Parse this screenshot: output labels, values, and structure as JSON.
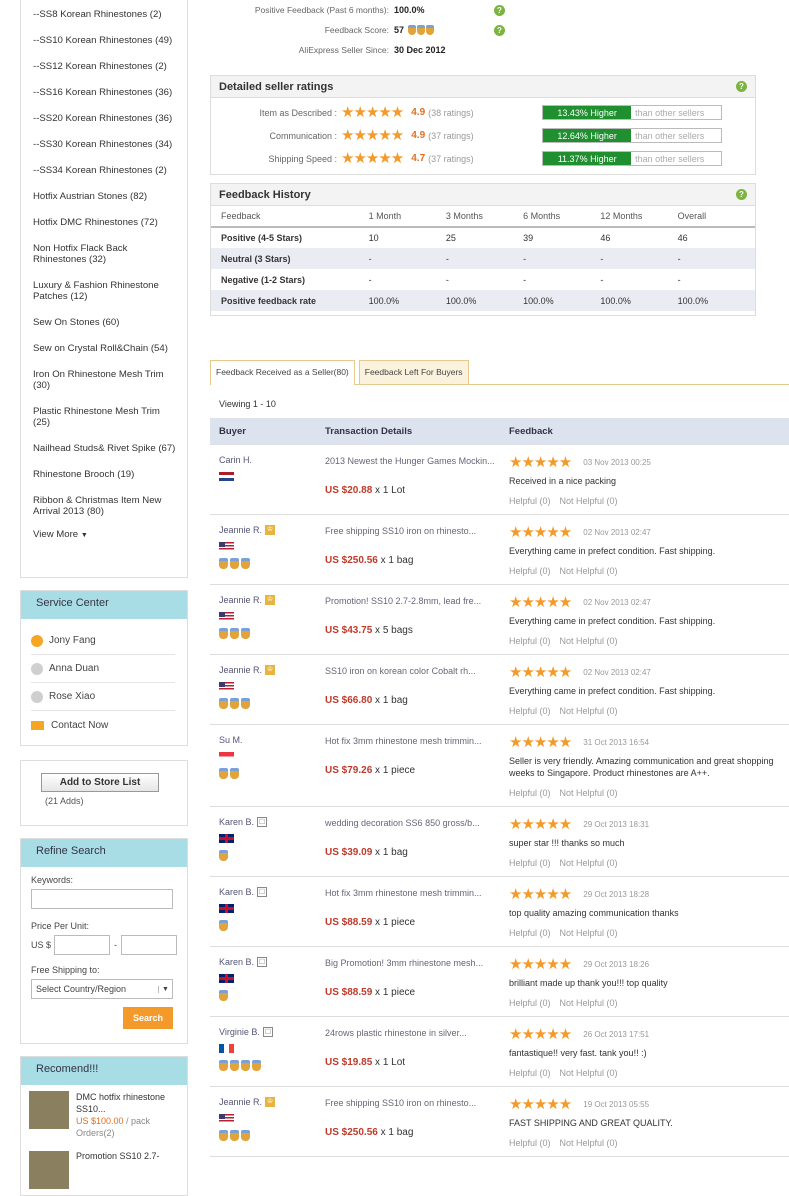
{
  "categories": [
    "--SS8 Korean Rhinestones (2)",
    "--SS10 Korean Rhinestones (49)",
    "--SS12 Korean Rhinestones (2)",
    "--SS16 Korean Rhinestones (36)",
    "--SS20 Korean Rhinestones (36)",
    "--SS30 Korean Rhinestones (34)",
    "--SS34 Korean Rhinestones (2)",
    "Hotfix Austrian Stones (82)",
    "Hotfix DMC Rhinestones (72)",
    "Non Hotfix Flack Back Rhinestones (32)",
    "Luxury & Fashion Rhinestone Patches (12)",
    "Sew On Stones (60)",
    "Sew on Crystal Roll&Chain (54)",
    "Iron On Rhinestone Mesh Trim (30)",
    "Plastic Rhinestone Mesh Trim (25)",
    "Nailhead Studs& Rivet Spike (67)",
    "Rhinestone Brooch (19)",
    "Ribbon & Christmas Item New Arrival 2013 (80)"
  ],
  "view_more": "View More",
  "service": {
    "title": "Service Center",
    "reps": [
      {
        "name": "Jony Fang",
        "color": "#f5a623"
      },
      {
        "name": "Anna Duan",
        "color": "#cfcfcf"
      },
      {
        "name": "Rose Xiao",
        "color": "#cfcfcf"
      }
    ],
    "contact": "Contact Now"
  },
  "store": {
    "button": "Add to Store List",
    "adds": "(21 Adds)"
  },
  "refine": {
    "title": "Refine Search",
    "keywords": "Keywords:",
    "price_label": "Price Per Unit:",
    "currency": "US $",
    "dash": "-",
    "ship_label": "Free Shipping to:",
    "country": "Select Country/Region",
    "search": "Search"
  },
  "recommend": {
    "title": "Recomend!!!",
    "items": [
      {
        "name": "DMC hotfix rhinestone SS10...",
        "price": "US $100.00",
        "unit": " / pack",
        "orders": "Orders(2)"
      },
      {
        "name": "Promotion SS10 2.7-"
      }
    ]
  },
  "seller": {
    "pos_label": "Positive Feedback (Past 6 months):",
    "pos_value": "100.0%",
    "score_label": "Feedback Score:",
    "score_value": "57",
    "since_label": "AliExpress Seller Since:",
    "since_value": "30 Dec 2012"
  },
  "ratings": {
    "title": "Detailed seller ratings",
    "rows": [
      {
        "label": "Item as Described :",
        "score": "4.9",
        "count": "(38 ratings)",
        "pct": "13.43% Higher",
        "than": "than other sellers"
      },
      {
        "label": "Communication :",
        "score": "4.9",
        "count": "(37 ratings)",
        "pct": "12.64% Higher",
        "than": "than other sellers"
      },
      {
        "label": "Shipping Speed :",
        "score": "4.7",
        "count": "(37 ratings)",
        "pct": "11.37% Higher",
        "than": "than other sellers"
      }
    ]
  },
  "history": {
    "title": "Feedback History",
    "headers": [
      "Feedback",
      "1 Month",
      "3 Months",
      "6 Months",
      "12 Months",
      "Overall"
    ],
    "rows": [
      [
        "Positive (4-5 Stars)",
        "10",
        "25",
        "39",
        "46",
        "46"
      ],
      [
        "Neutral (3 Stars)",
        "-",
        "-",
        "-",
        "-",
        "-"
      ],
      [
        "Negative (1-2 Stars)",
        "-",
        "-",
        "-",
        "-",
        "-"
      ],
      [
        "Positive feedback rate",
        "100.0%",
        "100.0%",
        "100.0%",
        "100.0%",
        "100.0%"
      ]
    ]
  },
  "tabs": [
    "Feedback Received as a Seller(80)",
    "Feedback Left For Buyers"
  ],
  "viewing": "Viewing 1 - 10",
  "fb_headers": [
    "Buyer",
    "Transaction Details",
    "Feedback"
  ],
  "helpful": "Helpful (0)",
  "not_helpful": "Not Helpful (0)",
  "feedback": [
    {
      "buyer": "Carin H.",
      "badge": "",
      "flag": "nl",
      "medals": 0,
      "desc": "2013 Newest the Hunger Games Mockin...",
      "price": "US $20.88",
      "qty": " x 1 Lot",
      "date": "03 Nov 2013 00:25",
      "text": "Received in a nice packing"
    },
    {
      "buyer": "Jeannie R.",
      "badge": "o",
      "flag": "us",
      "medals": 3,
      "desc": "Free shipping SS10 iron on rhinesto...",
      "price": "US $250.56",
      "qty": " x 1 bag",
      "date": "02 Nov 2013 02:47",
      "text": "Everything came in prefect condition. Fast shipping."
    },
    {
      "buyer": "Jeannie R.",
      "badge": "o",
      "flag": "us",
      "medals": 3,
      "desc": "Promotion! SS10 2.7-2.8mm, lead fre...",
      "price": "US $43.75",
      "qty": " x 5 bags",
      "date": "02 Nov 2013 02:47",
      "text": "Everything came in prefect condition. Fast shipping."
    },
    {
      "buyer": "Jeannie R.",
      "badge": "o",
      "flag": "us",
      "medals": 3,
      "desc": "SS10 iron on korean color Cobalt rh...",
      "price": "US $66.80",
      "qty": " x 1 bag",
      "date": "02 Nov 2013 02:47",
      "text": "Everything came in prefect condition. Fast shipping."
    },
    {
      "buyer": "Su M.",
      "badge": "",
      "flag": "sg",
      "medals": 2,
      "desc": "Hot fix 3mm rhinestone mesh trimmin...",
      "price": "US $79.26",
      "qty": " x 1 piece",
      "date": "31 Oct 2013 16:54",
      "text": "Seller is very friendly. Amazing communication and great shopping weeks to Singapore. Product rhinestones are A++."
    },
    {
      "buyer": "Karen B.",
      "badge": "g",
      "flag": "uk",
      "medals": 1,
      "desc": "wedding decoration SS6 850 gross/b...",
      "price": "US $39.09",
      "qty": " x 1 bag",
      "date": "29 Oct 2013 18:31",
      "text": "super star !!! thanks so much"
    },
    {
      "buyer": "Karen B.",
      "badge": "g",
      "flag": "uk",
      "medals": 1,
      "desc": "Hot fix 3mm rhinestone mesh trimmin...",
      "price": "US $88.59",
      "qty": " x 1 piece",
      "date": "29 Oct 2013 18:28",
      "text": "top quality amazing communication thanks"
    },
    {
      "buyer": "Karen B.",
      "badge": "g",
      "flag": "uk",
      "medals": 1,
      "desc": "Big Promotion! 3mm rhinestone mesh...",
      "price": "US $88.59",
      "qty": " x 1 piece",
      "date": "29 Oct 2013 18:26",
      "text": "brilliant made up thank you!!! top quality"
    },
    {
      "buyer": "Virginie B.",
      "badge": "g",
      "flag": "fr",
      "medals": 4,
      "desc": "24rows plastic rhinestone in silver...",
      "price": "US $19.85",
      "qty": " x 1 Lot",
      "date": "26 Oct 2013 17:51",
      "text": "fantastique!! very fast. tank you!! :)"
    },
    {
      "buyer": "Jeannie R.",
      "badge": "o",
      "flag": "us",
      "medals": 3,
      "desc": "Free shipping SS10 iron on rhinesto...",
      "price": "US $250.56",
      "qty": " x 1 bag",
      "date": "19 Oct 2013 05:55",
      "text": "FAST SHIPPING AND GREAT QUALITY."
    }
  ]
}
